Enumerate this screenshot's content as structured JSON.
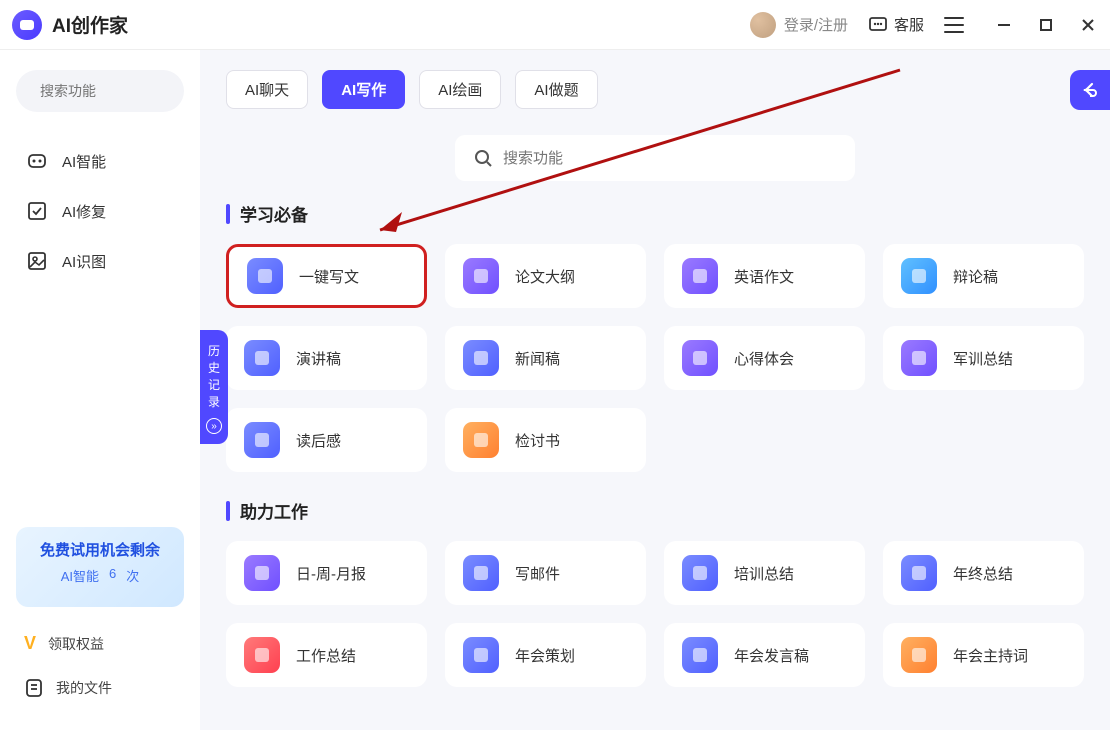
{
  "app": {
    "title": "AI创作家"
  },
  "titlebar": {
    "login": "登录/注册",
    "service": "客服"
  },
  "sidebar": {
    "search_placeholder": "搜索功能",
    "nav": [
      {
        "label": "AI智能"
      },
      {
        "label": "AI修复"
      },
      {
        "label": "AI识图"
      }
    ],
    "trial": {
      "title": "免费试用机会剩余",
      "feature": "AI智能",
      "count": "6",
      "unit": "次"
    },
    "links": [
      {
        "label": "领取权益"
      },
      {
        "label": "我的文件"
      }
    ]
  },
  "tabs": [
    "AI聊天",
    "AI写作",
    "AI绘画",
    "AI做题"
  ],
  "active_tab": 1,
  "main_search_placeholder": "搜索功能",
  "history_label": "历史记录",
  "sections": [
    {
      "title": "学习必备",
      "items": [
        {
          "label": "一键写文",
          "highlight": true,
          "ic": "ic-blue"
        },
        {
          "label": "论文大纲",
          "ic": "ic-purple"
        },
        {
          "label": "英语作文",
          "ic": "ic-purple"
        },
        {
          "label": "辩论稿",
          "ic": "ic-teal"
        },
        {
          "label": "演讲稿",
          "ic": "ic-blue"
        },
        {
          "label": "新闻稿",
          "ic": "ic-blue"
        },
        {
          "label": "心得体会",
          "ic": "ic-purple"
        },
        {
          "label": "军训总结",
          "ic": "ic-purple"
        },
        {
          "label": "读后感",
          "ic": "ic-blue"
        },
        {
          "label": "检讨书",
          "ic": "ic-orange"
        }
      ]
    },
    {
      "title": "助力工作",
      "items": [
        {
          "label": "日-周-月报",
          "ic": "ic-purple"
        },
        {
          "label": "写邮件",
          "ic": "ic-blue"
        },
        {
          "label": "培训总结",
          "ic": "ic-blue"
        },
        {
          "label": "年终总结",
          "ic": "ic-blue"
        },
        {
          "label": "工作总结",
          "ic": "ic-red"
        },
        {
          "label": "年会策划",
          "ic": "ic-blue"
        },
        {
          "label": "年会发言稿",
          "ic": "ic-blue"
        },
        {
          "label": "年会主持词",
          "ic": "ic-orange"
        }
      ]
    }
  ]
}
